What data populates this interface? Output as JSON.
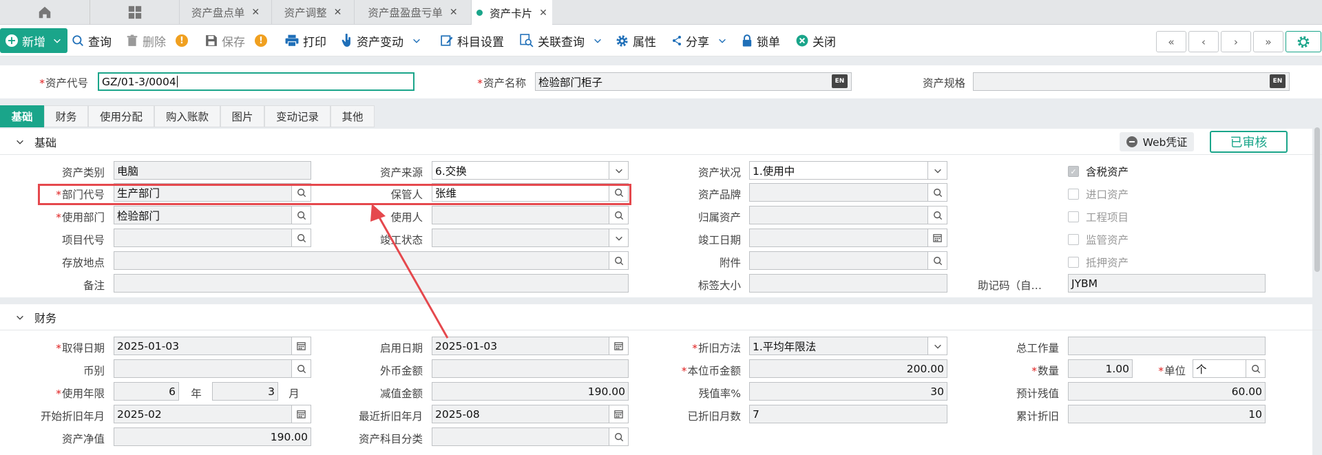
{
  "tabs": {
    "items": [
      {
        "label": "资产盘点单",
        "close": "✕"
      },
      {
        "label": "资产调整",
        "close": "✕"
      },
      {
        "label": "资产盘盈盘亏单",
        "close": "✕"
      },
      {
        "label": "资产卡片",
        "close": "✕"
      }
    ],
    "active_index": 3
  },
  "toolbar": {
    "new": "新增",
    "query": "查询",
    "delete": "删除",
    "save": "保存",
    "print": "打印",
    "asset_change": "资产变动",
    "subject_settings": "科目设置",
    "related_query": "关联查询",
    "properties": "属性",
    "share": "分享",
    "lock": "锁单",
    "close": "关闭",
    "warn_mark": "!"
  },
  "header": {
    "asset_code_label": "资产代号",
    "asset_code_value": "GZ/01-3/0004",
    "asset_name_label": "资产名称",
    "asset_name_value": "检验部门柜子",
    "asset_spec_label": "资产规格",
    "asset_spec_value": "",
    "lang_icon_text": "EN"
  },
  "section_tabs": [
    "基础",
    "财务",
    "使用分配",
    "购入账款",
    "图片",
    "变动记录",
    "其他"
  ],
  "basic": {
    "title": "基础",
    "web_voucher": "Web凭证",
    "audited": "已审核",
    "asset_category_label": "资产类别",
    "asset_category_value": "电脑",
    "asset_source_label": "资产来源",
    "asset_source_value": "6.交换",
    "asset_status_label": "资产状况",
    "asset_status_value": "1.使用中",
    "dept_code_label": "部门代号",
    "dept_code_value": "生产部门",
    "custodian_label": "保管人",
    "custodian_value": "张维",
    "asset_brand_label": "资产品牌",
    "asset_brand_value": "",
    "use_dept_label": "使用部门",
    "use_dept_value": "检验部门",
    "user_label": "使用人",
    "user_value": "",
    "parent_asset_label": "归属资产",
    "parent_asset_value": "",
    "project_code_label": "项目代号",
    "project_code_value": "",
    "completion_status_label": "竣工状态",
    "completion_status_value": "",
    "completion_date_label": "竣工日期",
    "completion_date_value": "",
    "location_label": "存放地点",
    "location_value": "",
    "attachment_label": "附件",
    "attachment_value": "",
    "remark_label": "备注",
    "remark_value": "",
    "label_size_label": "标签大小",
    "label_size_value": "",
    "mnemonic_label": "助记码（自…",
    "mnemonic_value": "JYBM",
    "checkboxes": [
      {
        "label": "含税资产",
        "checked": true
      },
      {
        "label": "进口资产",
        "checked": false
      },
      {
        "label": "工程项目",
        "checked": false
      },
      {
        "label": "监管资产",
        "checked": false
      },
      {
        "label": "抵押资产",
        "checked": false
      }
    ]
  },
  "finance": {
    "title": "财务",
    "acquire_date_label": "取得日期",
    "acquire_date_value": "2025-01-03",
    "enable_date_label": "启用日期",
    "enable_date_value": "2025-01-03",
    "depr_method_label": "折旧方法",
    "depr_method_value": "1.平均年限法",
    "total_workload_label": "总工作量",
    "total_workload_value": "",
    "currency_label": "币别",
    "currency_value": "",
    "foreign_amount_label": "外币金额",
    "foreign_amount_value": "",
    "local_amount_label": "本位币金额",
    "local_amount_value": "200.00",
    "quantity_label": "数量",
    "quantity_value": "1.00",
    "unit_label": "单位",
    "unit_value": "个",
    "useful_life_label": "使用年限",
    "useful_life_years": "6",
    "year_label": "年",
    "useful_life_months": "3",
    "month_label": "月",
    "impairment_label": "减值金额",
    "impairment_value": "190.00",
    "salvage_rate_label": "残值率%",
    "salvage_rate_value": "30",
    "est_salvage_label": "预计残值",
    "est_salvage_value": "60.00",
    "depr_start_label": "开始折旧年月",
    "depr_start_value": "2025-02",
    "last_depr_label": "最近折旧年月",
    "last_depr_value": "2025-08",
    "depr_months_label": "已折旧月数",
    "depr_months_value": "7",
    "accum_depr_label": "累计折旧",
    "accum_depr_value": "10",
    "net_value_label": "资产净值",
    "net_value_value": "190.00",
    "subject_class_label": "资产科目分类",
    "subject_class_value": ""
  },
  "colors": {
    "accent": "#1aa58a",
    "annotation": "#e5484d",
    "required": "#e02020"
  }
}
